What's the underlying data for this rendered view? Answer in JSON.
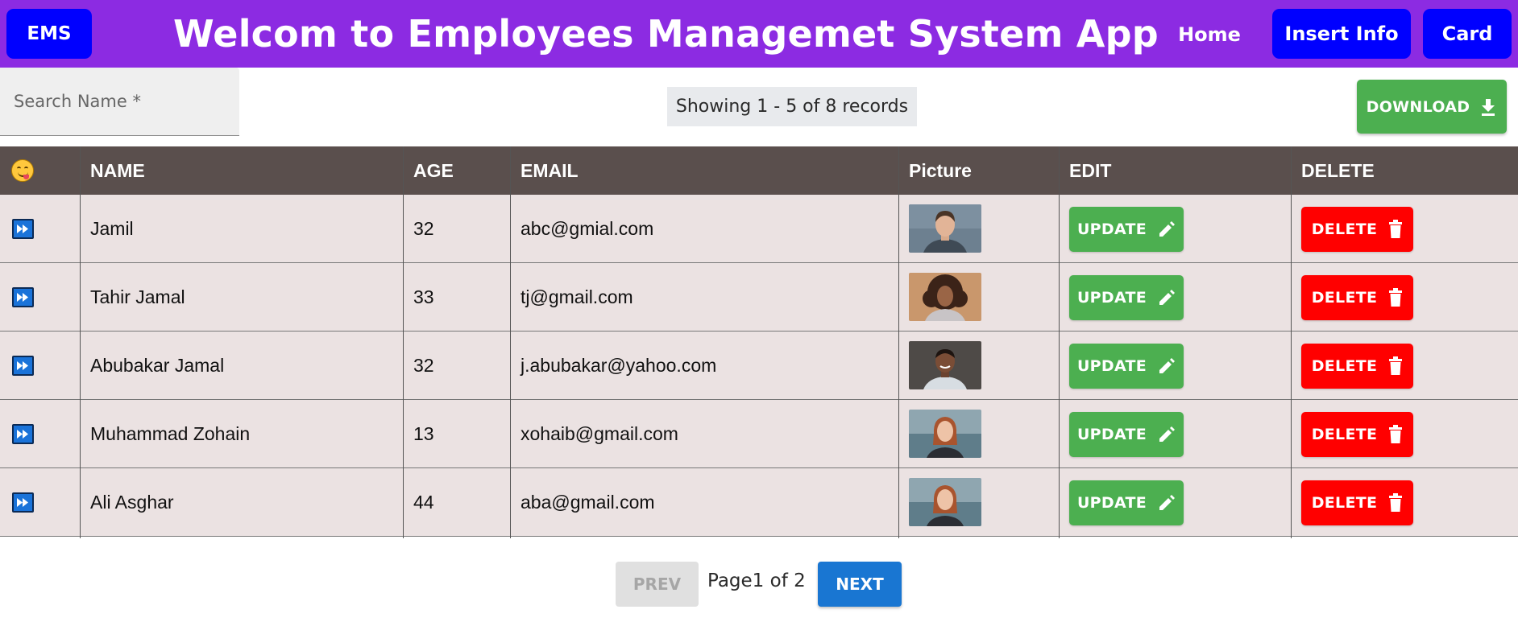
{
  "navbar": {
    "brand": "EMS",
    "title": "Welcom to Employees Managemet System App",
    "links": {
      "home": "Home",
      "insert": "Insert Info",
      "card": "Card"
    }
  },
  "toolbar": {
    "search_placeholder": "Search Name *",
    "records_text": "Showing 1 - 5 of 8 records",
    "download_label": "DOWNLOAD"
  },
  "table": {
    "columns": {
      "icon": "smiley-emoji-icon",
      "name": "NAME",
      "age": "AGE",
      "email": "EMAIL",
      "picture": "Picture",
      "edit": "EDIT",
      "delete": "DELETE"
    },
    "rows": [
      {
        "name": "Jamil",
        "age": "32",
        "email": "abc@gmial.com",
        "picture": "man-portrait-blue-background"
      },
      {
        "name": "Tahir Jamal",
        "age": "33",
        "email": "tj@gmail.com",
        "picture": "woman-curly-hair-portrait"
      },
      {
        "name": "Abubakar Jamal",
        "age": "32",
        "email": "j.abubakar@yahoo.com",
        "picture": "man-smiling-portrait"
      },
      {
        "name": "Muhammad Zohain",
        "age": "13",
        "email": "xohaib@gmail.com",
        "picture": "woman-red-hair-lake-portrait"
      },
      {
        "name": "Ali Asghar",
        "age": "44",
        "email": "aba@gmail.com",
        "picture": "woman-red-hair-lake-portrait"
      }
    ],
    "update_label": "UPDATE",
    "delete_label": "DELETE"
  },
  "pagination": {
    "prev_label": "PREV",
    "page_text": "Page1 of 2",
    "next_label": "NEXT"
  },
  "colors": {
    "navbar": "#8c2be2",
    "nav_button": "#0000ff",
    "header_row": "#5a4f4d",
    "row_bg": "#ebe2e2",
    "update": "#4caf50",
    "delete": "#ff0000",
    "next": "#1976d2"
  }
}
